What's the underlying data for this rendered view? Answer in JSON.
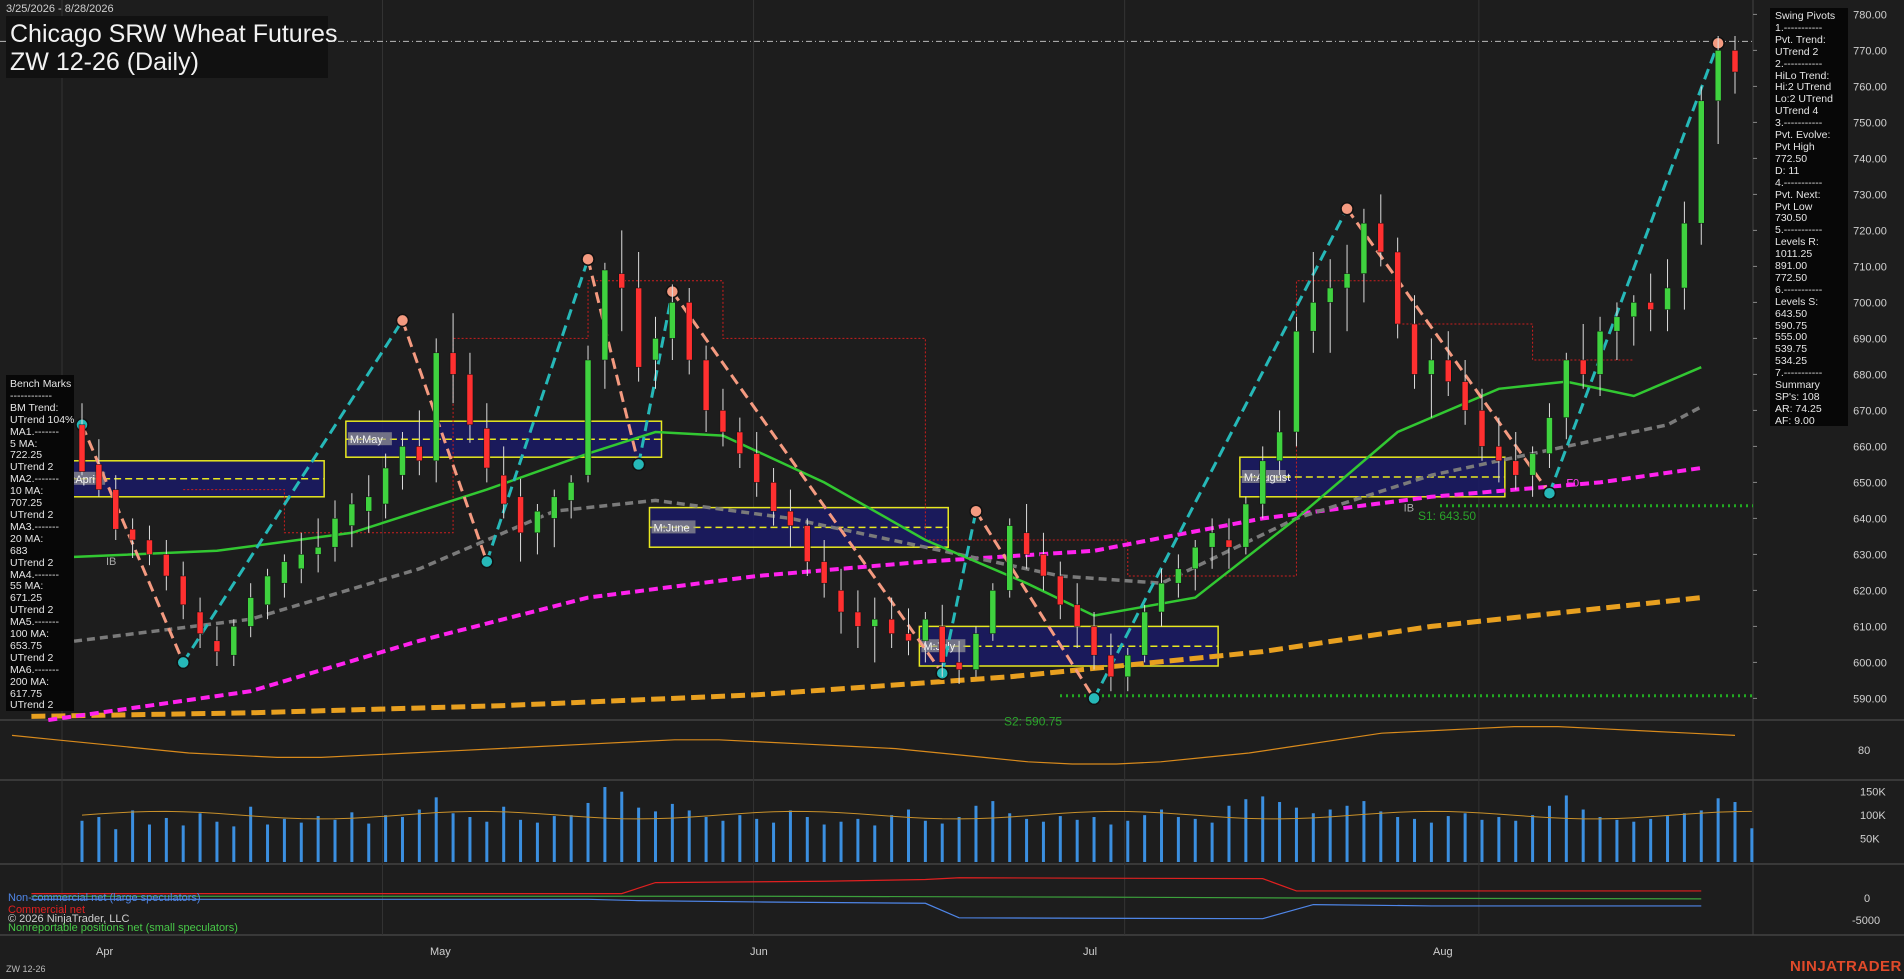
{
  "header": {
    "date_range": "3/25/2026 - 8/28/2026",
    "title": "Chicago SRW Wheat Futures",
    "subtitle": "ZW 12-26 (Daily)"
  },
  "benchmarks": {
    "lines": [
      "Bench Marks",
      "------------",
      "BM Trend:",
      "UTrend 104%",
      "MA1.-------",
      "5 MA:",
      "722.25",
      "UTrend 2",
      "MA2.-------",
      "10 MA:",
      "707.25",
      "UTrend 2",
      "MA3.-------",
      "20 MA:",
      "683",
      "UTrend 2",
      "MA4.-------",
      "55 MA:",
      "671.25",
      "UTrend 2",
      "MA5.-------",
      "100 MA:",
      "653.75",
      "UTrend 2",
      "MA6.-------",
      "200 MA:",
      "617.75",
      "UTrend 2"
    ]
  },
  "swing_pivots": {
    "lines": [
      "Swing Pivots",
      "1.-----------",
      "Pvt. Trend:",
      "UTrend 2",
      "2.-----------",
      "HiLo Trend:",
      "Hi:2 UTrend",
      "Lo:2 UTrend",
      "UTrend 4",
      "3.-----------",
      "Pvt. Evolve:",
      "Pvt High",
      "772.50",
      "D: 11",
      "4.-----------",
      "Pvt. Next:",
      "Pvt Low",
      "730.50",
      "5.-----------",
      "Levels R:",
      "1011.25",
      "891.00",
      "772.50",
      "6.-----------",
      "Levels S:",
      "643.50",
      "590.75",
      "555.00",
      "539.75",
      "534.25",
      "7.-----------",
      "Summary",
      "SP's: 108",
      "AR: 74.25",
      "AF: 9.00"
    ]
  },
  "legend": {
    "noncommercial": "Non-commercial net (large speculators)",
    "commercial": "Commercial net",
    "copyright": "© 2026 NinjaTrader, LLC",
    "nonreportable": "Nonreportable positions net (small speculators)"
  },
  "footer": {
    "symbol": "ZW 12-26",
    "brand": "NINJATRADER"
  },
  "colors": {
    "bull": "#3fd23f",
    "bear": "#ff3030",
    "ma20": "#32c832",
    "ma55": "#7a7a7a",
    "ma100": "#ff22ee",
    "ma200": "#e8a020",
    "swing_up": "#26b8b8",
    "swing_down": "#f49a80",
    "volume": "#3b8fe0",
    "box_fill": "#1a1a66",
    "box_border": "#e8e820"
  },
  "chart_data": {
    "type": "candlestick",
    "x_labels": [
      "Apr",
      "May",
      "Jun",
      "Jul",
      "Aug"
    ],
    "price_axis": {
      "min": 584,
      "max": 784,
      "ticks": [
        "780.00",
        "770.00",
        "760.00",
        "750.00",
        "740.00",
        "730.00",
        "720.00",
        "710.00",
        "700.00",
        "690.00",
        "680.00",
        "670.00",
        "660.00",
        "650.00",
        "640.00",
        "630.00",
        "620.00",
        "610.00",
        "600.00",
        "590.00"
      ]
    },
    "annotations": {
      "support1": "S1: 643.50",
      "support2": "S2: 590.75",
      "monthly_boxes": [
        "M:April",
        "M:May",
        "M:June",
        "M:July",
        "M:August"
      ],
      "marker_fd": "F0",
      "marker_ib": "IB"
    },
    "candles": [
      [
        666,
        672,
        652,
        653
      ],
      [
        655,
        662,
        646,
        648
      ],
      [
        648,
        652,
        634,
        637
      ],
      [
        637,
        640,
        629,
        634
      ],
      [
        634,
        638,
        627,
        630
      ],
      [
        630,
        634,
        620,
        624
      ],
      [
        624,
        628,
        612,
        616
      ],
      [
        614,
        618,
        604,
        608
      ],
      [
        606,
        610,
        599,
        603
      ],
      [
        602,
        612,
        599,
        610
      ],
      [
        610,
        622,
        607,
        618
      ],
      [
        616,
        626,
        612,
        624
      ],
      [
        622,
        630,
        618,
        628
      ],
      [
        626,
        636,
        622,
        630
      ],
      [
        630,
        640,
        625,
        632
      ],
      [
        632,
        645,
        628,
        640
      ],
      [
        638,
        647,
        632,
        644
      ],
      [
        642,
        652,
        636,
        646
      ],
      [
        644,
        658,
        640,
        654
      ],
      [
        652,
        664,
        648,
        660
      ],
      [
        660,
        670,
        652,
        656
      ],
      [
        656,
        690,
        650,
        686
      ],
      [
        686,
        697,
        672,
        680
      ],
      [
        680,
        686,
        661,
        666
      ],
      [
        665,
        672,
        650,
        654
      ],
      [
        652,
        660,
        640,
        644
      ],
      [
        646,
        651,
        628,
        636
      ],
      [
        636,
        644,
        630,
        642
      ],
      [
        640,
        648,
        632,
        646
      ],
      [
        645,
        652,
        640,
        650
      ],
      [
        652,
        688,
        650,
        684
      ],
      [
        684,
        711,
        676,
        709
      ],
      [
        708,
        720,
        692,
        704
      ],
      [
        704,
        714,
        678,
        682
      ],
      [
        684,
        696,
        676,
        690
      ],
      [
        690,
        705,
        684,
        700
      ],
      [
        700,
        704,
        680,
        684
      ],
      [
        684,
        688,
        664,
        670
      ],
      [
        670,
        676,
        660,
        664
      ],
      [
        664,
        668,
        654,
        658
      ],
      [
        658,
        664,
        646,
        650
      ],
      [
        650,
        654,
        638,
        642
      ],
      [
        642,
        648,
        632,
        638
      ],
      [
        638,
        640,
        624,
        628
      ],
      [
        628,
        634,
        618,
        622
      ],
      [
        620,
        626,
        608,
        614
      ],
      [
        614,
        620,
        604,
        610
      ],
      [
        610,
        618,
        600,
        612
      ],
      [
        612,
        618,
        604,
        608
      ],
      [
        608,
        615,
        602,
        606
      ],
      [
        606,
        614,
        600,
        612
      ],
      [
        610,
        616,
        596,
        600
      ],
      [
        600,
        606,
        594,
        598
      ],
      [
        598,
        610,
        596,
        608
      ],
      [
        608,
        622,
        606,
        620
      ],
      [
        620,
        640,
        618,
        638
      ],
      [
        636,
        644,
        626,
        630
      ],
      [
        630,
        636,
        620,
        624
      ],
      [
        624,
        628,
        612,
        616
      ],
      [
        616,
        622,
        604,
        610
      ],
      [
        610,
        614,
        598,
        602
      ],
      [
        602,
        608,
        592,
        596
      ],
      [
        596,
        604,
        592,
        602
      ],
      [
        602,
        616,
        600,
        614
      ],
      [
        614,
        626,
        610,
        622
      ],
      [
        622,
        630,
        618,
        626
      ],
      [
        626,
        634,
        620,
        632
      ],
      [
        632,
        640,
        626,
        636
      ],
      [
        634,
        640,
        626,
        632
      ],
      [
        632,
        646,
        630,
        644
      ],
      [
        644,
        660,
        640,
        656
      ],
      [
        656,
        670,
        652,
        664
      ],
      [
        664,
        696,
        660,
        692
      ],
      [
        692,
        714,
        686,
        700
      ],
      [
        700,
        712,
        686,
        704
      ],
      [
        704,
        716,
        692,
        708
      ],
      [
        708,
        726,
        700,
        722
      ],
      [
        722,
        730,
        710,
        714
      ],
      [
        714,
        718,
        690,
        694
      ],
      [
        694,
        702,
        676,
        680
      ],
      [
        680,
        690,
        668,
        684
      ],
      [
        684,
        692,
        674,
        678
      ],
      [
        678,
        684,
        666,
        670
      ],
      [
        670,
        676,
        656,
        660
      ],
      [
        660,
        668,
        650,
        656
      ],
      [
        656,
        664,
        648,
        652
      ],
      [
        652,
        660,
        646,
        658
      ],
      [
        658,
        672,
        654,
        668
      ],
      [
        668,
        686,
        662,
        684
      ],
      [
        684,
        694,
        676,
        680
      ],
      [
        680,
        696,
        674,
        692
      ],
      [
        692,
        700,
        684,
        696
      ],
      [
        696,
        702,
        688,
        700
      ],
      [
        700,
        708,
        692,
        698
      ],
      [
        698,
        712,
        692,
        704
      ],
      [
        704,
        728,
        698,
        722
      ],
      [
        722,
        760,
        716,
        756
      ],
      [
        756,
        774,
        744,
        770
      ],
      [
        770,
        774,
        758,
        764
      ]
    ],
    "volume": [
      88,
      96,
      70,
      110,
      80,
      94,
      78,
      104,
      86,
      76,
      118,
      80,
      92,
      84,
      98,
      90,
      106,
      82,
      100,
      96,
      112,
      138,
      104,
      96,
      86,
      118,
      90,
      84,
      98,
      100,
      126,
      160,
      150,
      116,
      108,
      124,
      110,
      96,
      88,
      100,
      92,
      84,
      110,
      96,
      80,
      86,
      92,
      78,
      100,
      112,
      88,
      82,
      96,
      120,
      130,
      104,
      92,
      86,
      98,
      90,
      96,
      80,
      88,
      100,
      112,
      96,
      92,
      84,
      120,
      134,
      140,
      128,
      116,
      104,
      112,
      120,
      130,
      108,
      96,
      92,
      84,
      98,
      104,
      90,
      96,
      88,
      100,
      120,
      142,
      112,
      96,
      90,
      86,
      92,
      98,
      104,
      110,
      136,
      128,
      72
    ]
  }
}
